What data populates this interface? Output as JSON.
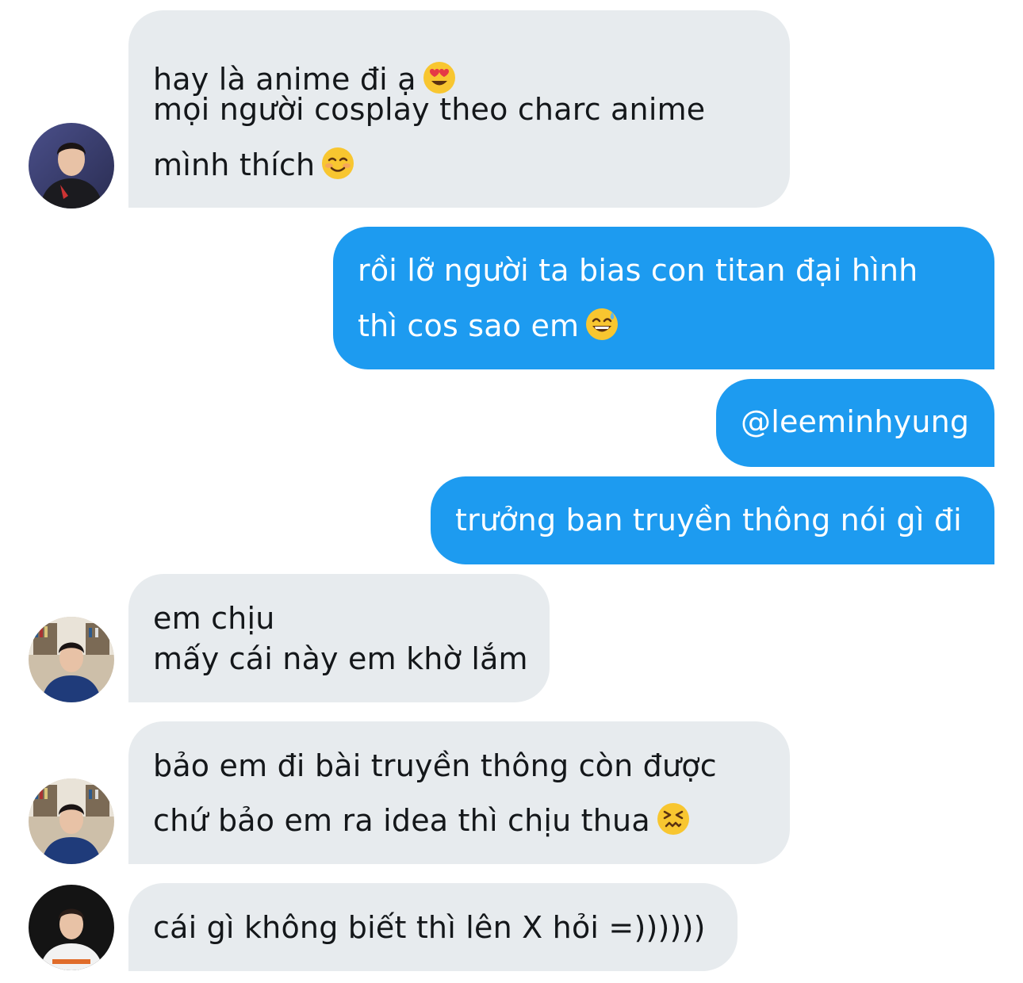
{
  "messages": [
    {
      "sender": "other",
      "lines": [
        "hay là anime đi ạ",
        "mọi người cosplay theo charc anime",
        "mình thích"
      ],
      "emojis": [
        "heart-eyes",
        "smiling-blush"
      ]
    },
    {
      "sender": "me",
      "lines": [
        "rồi lỡ người ta bias con titan đại hình",
        "thì cos sao em"
      ],
      "emojis": [
        "grinning-sweat"
      ]
    },
    {
      "sender": "me",
      "lines": [
        "@leeminhyung"
      ]
    },
    {
      "sender": "me",
      "lines": [
        "trưởng ban truyền thông nói gì đi"
      ]
    },
    {
      "sender": "other",
      "lines": [
        "em chịu",
        "mấy cái này em khờ lắm"
      ]
    },
    {
      "sender": "other",
      "lines": [
        "bảo em đi bài truyền thông còn được",
        "chứ bảo em ra idea thì chịu thua"
      ],
      "emojis": [
        "confounded"
      ]
    },
    {
      "sender": "other",
      "lines": [
        "cái gì không biết thì lên X hỏi =))))))"
      ]
    }
  ],
  "colors": {
    "incoming_bubble": "#e7ebee",
    "outgoing_bubble": "#1d9bf0",
    "incoming_text": "#14171a",
    "outgoing_text": "#ffffff"
  },
  "avatars": [
    "avatar-player-dark-jersey",
    "avatar-player-blue-shirt",
    "avatar-player-blue-shirt",
    "avatar-player-white-jersey"
  ]
}
